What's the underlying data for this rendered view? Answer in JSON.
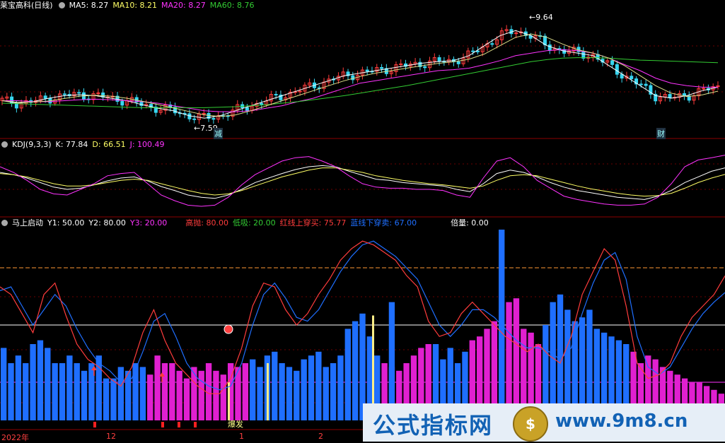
{
  "panel1": {
    "title": "莱宝高科(日线)",
    "ma5": "MA5: 8.27",
    "ma10": "MA10: 8.21",
    "ma20": "MA20: 8.27",
    "ma60": "MA60: 8.76",
    "low_label": "←7.59",
    "high_label": "←9.64",
    "marker1": "减",
    "marker2": "财"
  },
  "panel2": {
    "title": "KDJ(9,3,3)",
    "k": "K: 77.84",
    "d": "D: 66.51",
    "j": "J: 100.49"
  },
  "panel3": {
    "title": "马上启动",
    "y1": "Y1: 50.00",
    "y2": "Y2: 80.00",
    "y3": "Y3: 20.00",
    "gaopao": "高抛: 80.00",
    "dixi": "低吸: 20.00",
    "red_cross": "红线上穿买: 75.77",
    "blue_cross": "蓝线下穿卖: 67.00",
    "beiliang": "倍量: 0.00",
    "burst": "爆发"
  },
  "xaxis": {
    "labels": [
      "2022年",
      "12",
      "1",
      "2"
    ]
  },
  "watermark": {
    "left": "公式指标网",
    "logo": "$",
    "right": "www.9m8.cn"
  },
  "colors": {
    "up": "#ff3c3c",
    "down": "#38d6f0",
    "ma5": "#ffffff",
    "ma10": "#ffff66",
    "ma20": "#ff33ff",
    "ma60": "#33cc33",
    "blue": "#1f6fff",
    "magenta": "#e020d0"
  },
  "chart_data": [
    {
      "type": "line",
      "title": "莱宝高科(日线)",
      "ylim": [
        7.4,
        9.8
      ],
      "series": [
        {
          "name": "MA5",
          "values": [
            8.0,
            7.95,
            7.98,
            8.05,
            8.1,
            8.12,
            8.1,
            8.05,
            8.0,
            7.92,
            7.85,
            7.8,
            7.7,
            7.65,
            7.7,
            7.8,
            7.9,
            8.0,
            8.1,
            8.2,
            8.3,
            8.4,
            8.5,
            8.55,
            8.6,
            8.65,
            8.7,
            8.75,
            8.78,
            8.8,
            8.9,
            9.1,
            9.3,
            9.4,
            9.3,
            9.1,
            9.0,
            8.95,
            8.9,
            8.7,
            8.5,
            8.3,
            8.1,
            8.05,
            8.1,
            8.2,
            8.27
          ]
        },
        {
          "name": "MA20",
          "values": [
            8.0,
            8.0,
            7.98,
            7.98,
            8.0,
            8.02,
            8.03,
            8.02,
            8.0,
            7.98,
            7.95,
            7.9,
            7.85,
            7.8,
            7.78,
            7.78,
            7.8,
            7.85,
            7.9,
            7.98,
            8.05,
            8.15,
            8.25,
            8.35,
            8.4,
            8.45,
            8.5,
            8.55,
            8.6,
            8.62,
            8.65,
            8.72,
            8.8,
            8.9,
            8.95,
            9.0,
            9.02,
            9.0,
            8.95,
            8.85,
            8.72,
            8.6,
            8.45,
            8.35,
            8.3,
            8.27,
            8.27
          ]
        },
        {
          "name": "MA60",
          "values": [
            7.95,
            7.94,
            7.93,
            7.92,
            7.91,
            7.9,
            7.89,
            7.88,
            7.87,
            7.86,
            7.86,
            7.86,
            7.86,
            7.86,
            7.87,
            7.88,
            7.9,
            7.92,
            7.95,
            7.98,
            8.02,
            8.06,
            8.1,
            8.15,
            8.2,
            8.25,
            8.3,
            8.36,
            8.42,
            8.48,
            8.54,
            8.6,
            8.66,
            8.72,
            8.78,
            8.82,
            8.85,
            8.86,
            8.86,
            8.85,
            8.83,
            8.81,
            8.8,
            8.79,
            8.78,
            8.77,
            8.76
          ]
        }
      ]
    },
    {
      "type": "line",
      "title": "KDJ(9,3,3)",
      "ylim": [
        0,
        110
      ],
      "series": [
        {
          "name": "K",
          "values": [
            70,
            66,
            60,
            52,
            44,
            40,
            42,
            48,
            55,
            60,
            62,
            55,
            45,
            38,
            30,
            26,
            24,
            30,
            40,
            52,
            60,
            68,
            75,
            80,
            82,
            80,
            72,
            65,
            58,
            56,
            52,
            50,
            48,
            46,
            40,
            36,
            50,
            68,
            74,
            70,
            62,
            52,
            44,
            38,
            34,
            30,
            26,
            24,
            22,
            28,
            38,
            52,
            62,
            72,
            78
          ]
        },
        {
          "name": "D",
          "values": [
            68,
            66,
            62,
            56,
            50,
            46,
            46,
            48,
            52,
            56,
            58,
            56,
            50,
            44,
            38,
            33,
            30,
            32,
            38,
            46,
            54,
            62,
            68,
            74,
            78,
            78,
            74,
            70,
            64,
            60,
            56,
            53,
            50,
            48,
            45,
            42,
            46,
            56,
            64,
            66,
            64,
            58,
            52,
            46,
            41,
            37,
            33,
            30,
            28,
            29,
            33,
            42,
            52,
            60,
            66.5
          ]
        },
        {
          "name": "J",
          "values": [
            80,
            70,
            56,
            40,
            32,
            30,
            40,
            50,
            64,
            68,
            70,
            50,
            30,
            20,
            12,
            10,
            12,
            26,
            48,
            66,
            78,
            90,
            96,
            98,
            90,
            80,
            64,
            50,
            44,
            42,
            42,
            40,
            40,
            38,
            30,
            26,
            60,
            90,
            96,
            80,
            56,
            42,
            28,
            22,
            18,
            14,
            12,
            12,
            14,
            26,
            50,
            80,
            92,
            96,
            100.5
          ]
        }
      ]
    },
    {
      "type": "bar",
      "title": "马上启动",
      "ylim": [
        0,
        100
      ],
      "series": [
        {
          "name": "Y1",
          "values": [
            50
          ]
        },
        {
          "name": "Y2",
          "values": [
            80
          ]
        },
        {
          "name": "Y3",
          "values": [
            20
          ]
        },
        {
          "name": "高抛",
          "values": [
            80
          ]
        },
        {
          "name": "低吸",
          "values": [
            20
          ]
        },
        {
          "name": "红线上穿买",
          "values": [
            75.77
          ]
        },
        {
          "name": "蓝线下穿卖",
          "values": [
            67.0
          ]
        },
        {
          "name": "倍量",
          "values": [
            0.0
          ]
        }
      ],
      "red_line": [
        70,
        66,
        56,
        46,
        66,
        72,
        55,
        40,
        32,
        28,
        22,
        18,
        28,
        46,
        58,
        42,
        30,
        24,
        18,
        14,
        14,
        22,
        38,
        60,
        72,
        70,
        58,
        50,
        56,
        66,
        74,
        84,
        90,
        94,
        92,
        88,
        84,
        76,
        70,
        52,
        44,
        46,
        56,
        62,
        56,
        50,
        44,
        40,
        36,
        40,
        34,
        30,
        44,
        66,
        78,
        90,
        84,
        60,
        30,
        22,
        24,
        30,
        44,
        54,
        60,
        66,
        75.77
      ],
      "blue_line": [
        68,
        70,
        60,
        50,
        58,
        66,
        60,
        48,
        38,
        30,
        26,
        20,
        22,
        36,
        52,
        56,
        44,
        30,
        22,
        18,
        16,
        18,
        30,
        50,
        66,
        72,
        64,
        54,
        52,
        58,
        68,
        78,
        86,
        92,
        94,
        90,
        86,
        80,
        74,
        62,
        50,
        44,
        50,
        58,
        58,
        54,
        48,
        42,
        38,
        38,
        36,
        32,
        38,
        56,
        72,
        84,
        88,
        74,
        44,
        28,
        24,
        28,
        38,
        48,
        56,
        62,
        67
      ],
      "bars": [
        38,
        30,
        34,
        30,
        40,
        42,
        38,
        30,
        30,
        34,
        30,
        26,
        30,
        34,
        22,
        22,
        28,
        26,
        30,
        28,
        24,
        34,
        30,
        30,
        26,
        22,
        28,
        26,
        30,
        26,
        24,
        30,
        28,
        30,
        32,
        28,
        34,
        36,
        30,
        28,
        26,
        32,
        34,
        36,
        28,
        30,
        34,
        48,
        52,
        56,
        44,
        34,
        30,
        28,
        26,
        30,
        34,
        38,
        40,
        40,
        32,
        38,
        30,
        36,
        42,
        44,
        48,
        52,
        58,
        62,
        64,
        48,
        46,
        40,
        50,
        62,
        66,
        58,
        52,
        54,
        58,
        48,
        46,
        44,
        42,
        40,
        36,
        30,
        34,
        32,
        28,
        26,
        24,
        22,
        20,
        20,
        18,
        16,
        14
      ]
    }
  ]
}
